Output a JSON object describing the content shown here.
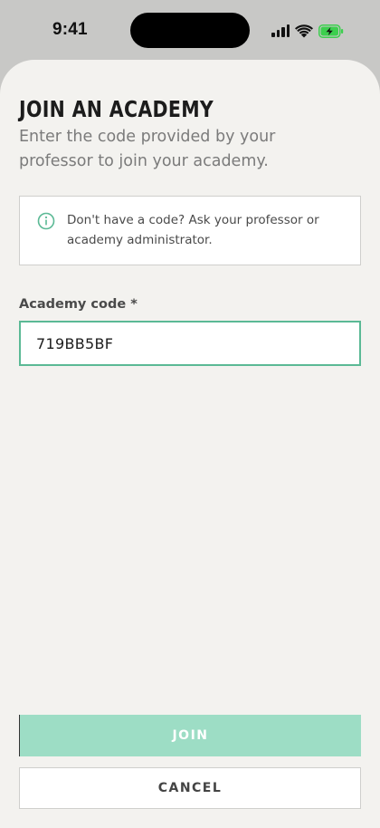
{
  "status_bar": {
    "time": "9:41",
    "icons": [
      "cellular-signal-icon",
      "wifi-icon",
      "battery-charging-icon"
    ]
  },
  "sheet": {
    "title": "JOIN AN ACADEMY",
    "subtitle": "Enter the code provided by your professor to join your academy.",
    "info": {
      "icon": "info-icon",
      "text": "Don't have a code? Ask your professor or academy administrator."
    },
    "field": {
      "label": "Academy code *",
      "value": "719BB5BF"
    },
    "actions": {
      "join_label": "JOIN",
      "cancel_label": "CANCEL"
    }
  },
  "colors": {
    "accent": "#5bb995",
    "join_button_bg": "#9dddc5",
    "sheet_bg": "#f3f2ef",
    "battery": "#3ccf4e"
  }
}
